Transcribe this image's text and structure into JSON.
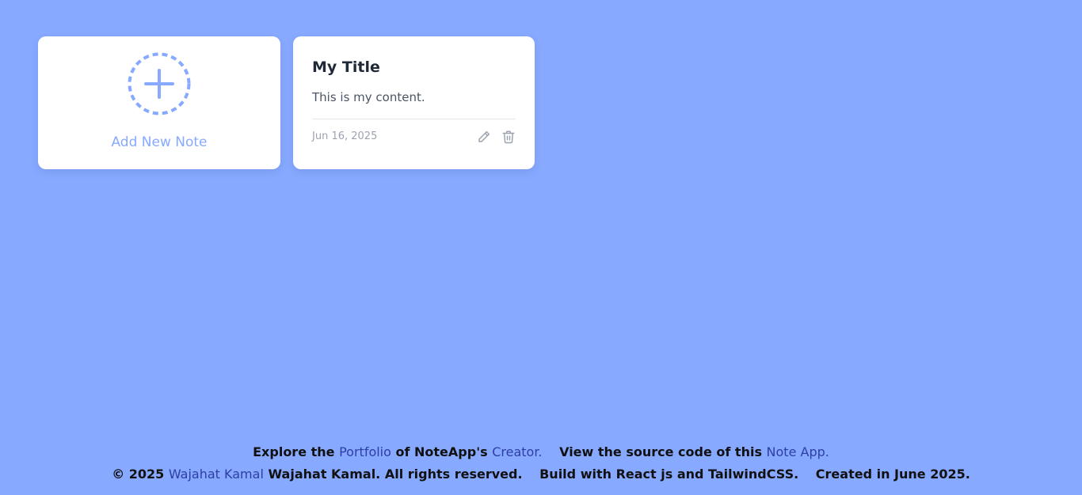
{
  "add_card": {
    "label": "Add New Note",
    "icon": "plus-circle-icon"
  },
  "notes": [
    {
      "title": "My Title",
      "content": "This is my content.",
      "date": "Jun 16, 2025",
      "edit_icon": "pencil-icon",
      "delete_icon": "trash-icon"
    }
  ],
  "footer": {
    "line1": {
      "explore_prefix": "Explore the",
      "portfolio_link": "Portfolio",
      "explore_middle": "of NoteApp's",
      "creator_link": "Creator.",
      "source_prefix": "View the source code of this",
      "source_link": "Note App."
    },
    "line2": {
      "copyright_prefix": "© 2025",
      "author_link": "Wajahat Kamal",
      "rights_text": "Wajahat Kamal. All rights reserved.",
      "built_text": "Build with React js and TailwindCSS.",
      "created_text": "Created in June 2025."
    }
  },
  "colors": {
    "background": "#87a9ff",
    "accent": "#87a9ff",
    "link": "#2d3fa3"
  }
}
